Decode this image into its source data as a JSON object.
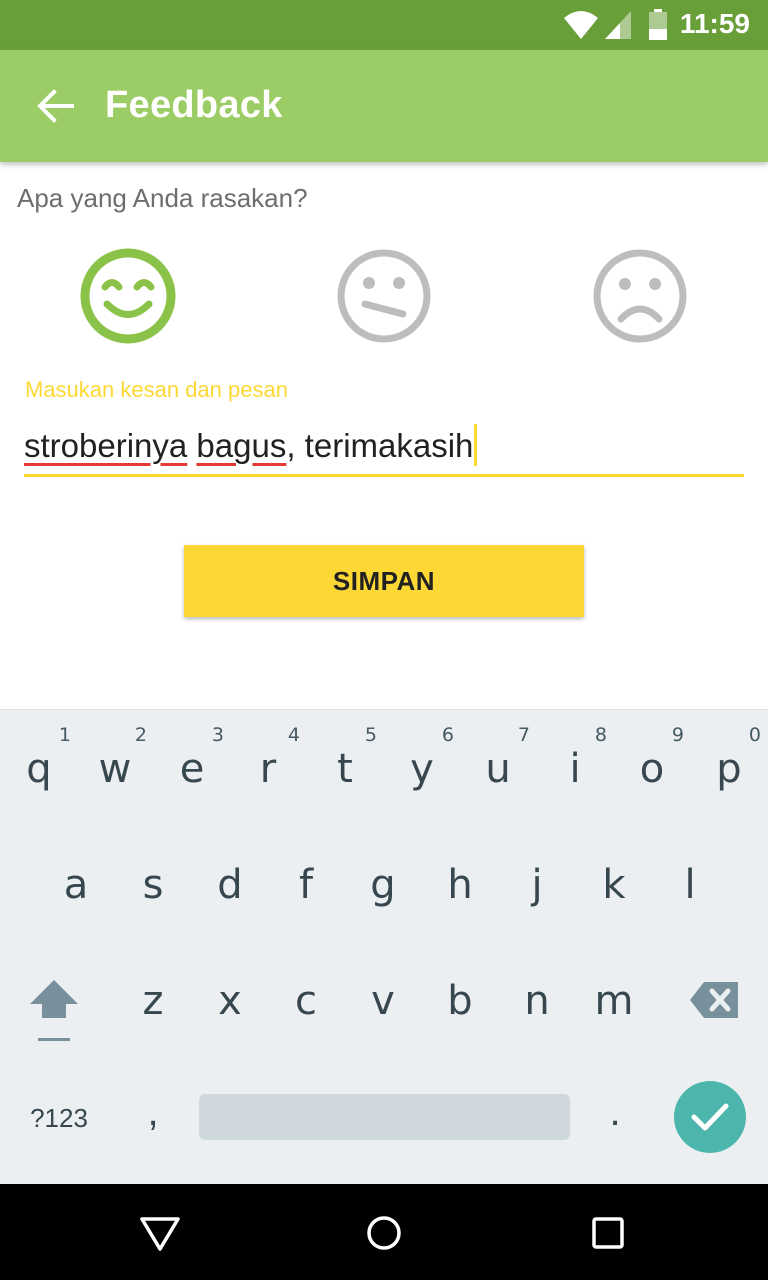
{
  "status_bar": {
    "time": "11:59"
  },
  "app_bar": {
    "title": "Feedback"
  },
  "feedback": {
    "question": "Apa yang Anda rasakan?",
    "moods": [
      {
        "name": "happy",
        "selected": true,
        "color": "#8bc34a"
      },
      {
        "name": "neutral",
        "selected": false,
        "color": "#bdbdbd"
      },
      {
        "name": "sad",
        "selected": false,
        "color": "#bdbdbd"
      }
    ],
    "input_label": "Masukan kesan dan pesan",
    "input_value_parts": {
      "w1": "stroberinya",
      "sp1": " ",
      "w2": "bagus",
      "rest": ", terimakasih"
    },
    "save_label": "SIMPAN"
  },
  "keyboard": {
    "row1": [
      {
        "ch": "q",
        "hint": "1"
      },
      {
        "ch": "w",
        "hint": "2"
      },
      {
        "ch": "e",
        "hint": "3"
      },
      {
        "ch": "r",
        "hint": "4"
      },
      {
        "ch": "t",
        "hint": "5"
      },
      {
        "ch": "y",
        "hint": "6"
      },
      {
        "ch": "u",
        "hint": "7"
      },
      {
        "ch": "i",
        "hint": "8"
      },
      {
        "ch": "o",
        "hint": "9"
      },
      {
        "ch": "p",
        "hint": "0"
      }
    ],
    "row2": [
      "a",
      "s",
      "d",
      "f",
      "g",
      "h",
      "j",
      "k",
      "l"
    ],
    "row3": [
      "z",
      "x",
      "c",
      "v",
      "b",
      "n",
      "m"
    ],
    "symbols_label": "?123",
    "comma": ",",
    "period": ".",
    "accent_color": "#4db6ac"
  },
  "colors": {
    "status_bar": "#689f38",
    "app_bar": "#9ccc65",
    "accent_yellow": "#fdd835"
  }
}
